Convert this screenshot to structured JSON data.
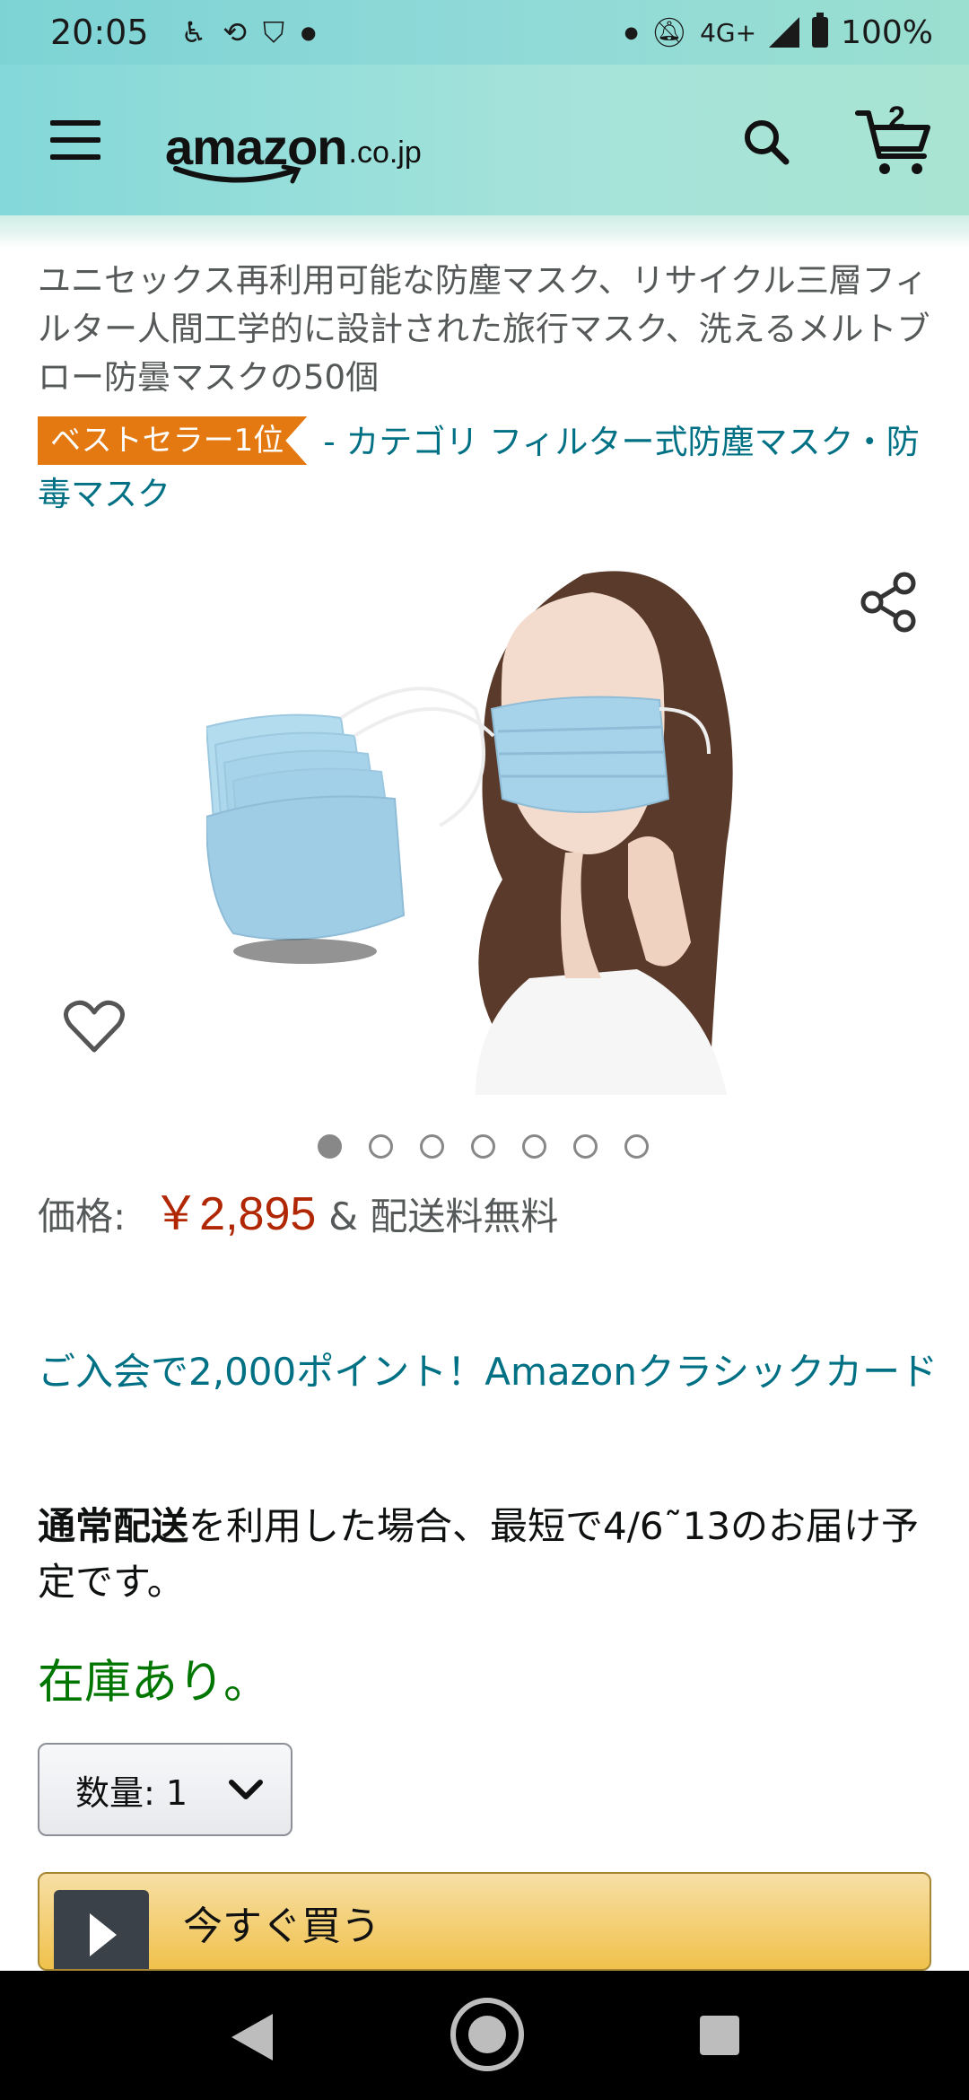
{
  "status_bar": {
    "time": "20:05",
    "network": "4G+",
    "battery": "100%",
    "icons": [
      "accessibility-icon",
      "sync-icon",
      "shield-check-icon",
      "dot-icon",
      "notification-dot-icon",
      "bell-off-icon",
      "signal-icon",
      "battery-icon"
    ]
  },
  "header": {
    "logo_main": "amazon",
    "logo_sub": ".co.jp",
    "cart_count": "2",
    "colors": {
      "gradient_start": "#84d8d9",
      "gradient_end": "#a9e4d2"
    }
  },
  "product": {
    "title": "ユニセックス再利用可能な防塵マスク、リサイクル三層フィルター人間工学的に設計された旅行マスク、洗えるメルトブロー防曇マスクの50個",
    "bestseller_badge": "ベストセラー1位",
    "category_text": "- カテゴリ フィルター式防塵マスク・防毒マスク",
    "image_count": 7,
    "active_image_index": 0
  },
  "price": {
    "label": "価格:",
    "value": "￥2,895",
    "shipping": "& 配送料無料"
  },
  "promo": {
    "card_text": "ご入会で2,000ポイント！Amazonクラシックカード"
  },
  "delivery": {
    "bold_part": "通常配送",
    "rest": "を利用した場合、最短で4/6˜13のお届け予定です。"
  },
  "stock": {
    "status": "在庫あり。"
  },
  "quantity": {
    "label": "数量: 1"
  },
  "buy_now": {
    "label": "今すぐ買う"
  },
  "colors": {
    "link": "#007185",
    "price": "#b12704",
    "stock": "#007600",
    "badge": "#e47911",
    "buy_button": "#f0c14b"
  }
}
